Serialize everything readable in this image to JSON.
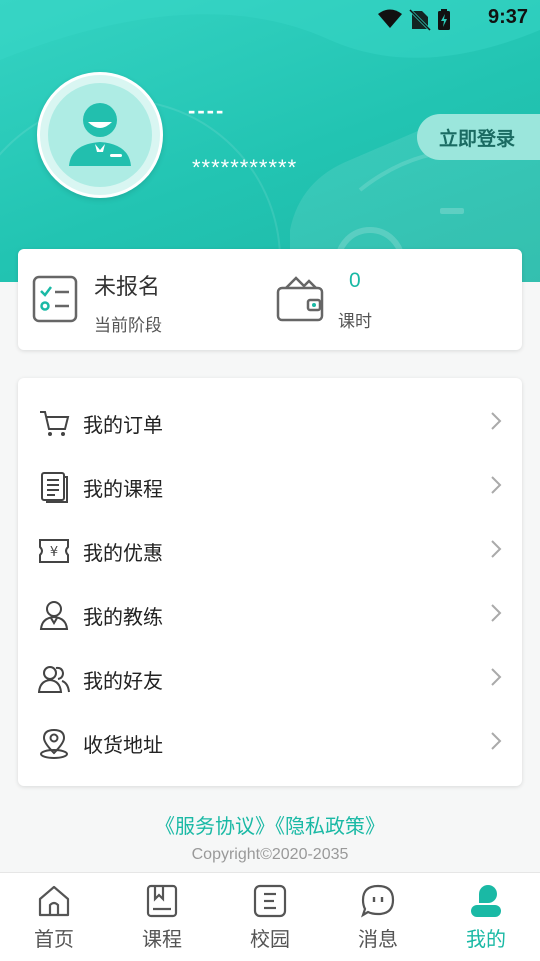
{
  "status_bar": {
    "time": "9:37"
  },
  "header": {
    "user_name": "----",
    "user_phone": "***********",
    "login_button": "立即登录"
  },
  "stats": {
    "stage_value": "未报名",
    "stage_label": "当前阶段",
    "hours_value": "0",
    "hours_label": "课时"
  },
  "menu": {
    "items": [
      {
        "label": "我的订单",
        "icon": "cart-icon"
      },
      {
        "label": "我的课程",
        "icon": "document-icon"
      },
      {
        "label": "我的优惠",
        "icon": "coupon-icon"
      },
      {
        "label": "我的教练",
        "icon": "coach-icon"
      },
      {
        "label": "我的好友",
        "icon": "friends-icon"
      },
      {
        "label": "收货地址",
        "icon": "location-icon"
      }
    ]
  },
  "footer": {
    "service_agreement": "《服务协议》",
    "privacy_policy": "《隐私政策》",
    "copyright": "Copyright©2020-2035"
  },
  "bottom_nav": {
    "items": [
      {
        "label": "首页",
        "icon": "home-icon"
      },
      {
        "label": "课程",
        "icon": "book-icon"
      },
      {
        "label": "校园",
        "icon": "campus-icon"
      },
      {
        "label": "消息",
        "icon": "message-icon"
      },
      {
        "label": "我的",
        "icon": "profile-icon",
        "active": true
      }
    ]
  },
  "colors": {
    "accent": "#1ab9a5",
    "header_gradient_start": "#35d3c3",
    "header_gradient_end": "#1eb8a6"
  }
}
